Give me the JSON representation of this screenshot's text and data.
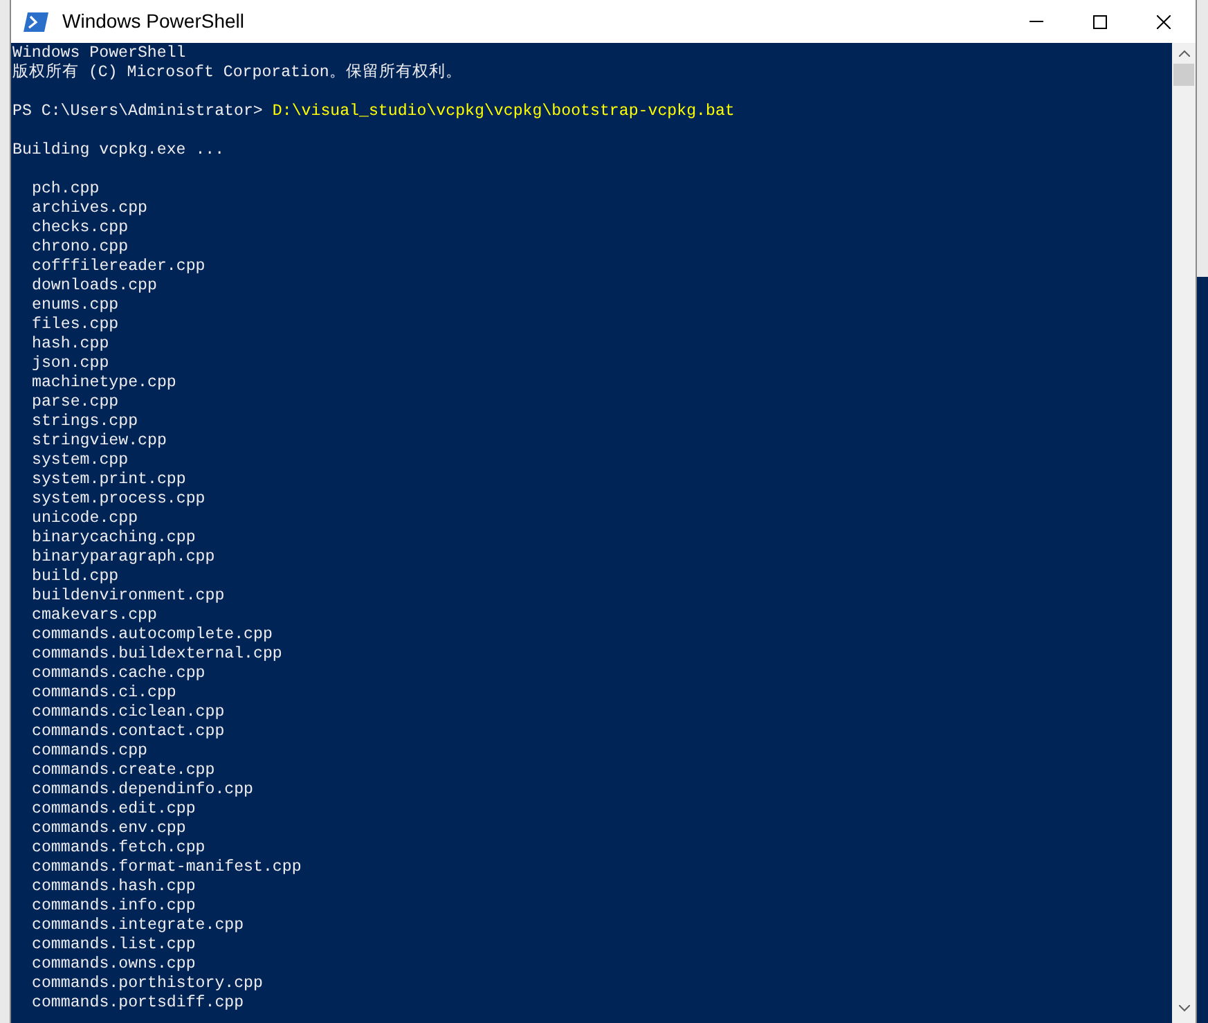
{
  "window": {
    "title": "Windows PowerShell"
  },
  "console": {
    "lines": [
      {
        "kind": "output",
        "text": "Windows PowerShell"
      },
      {
        "kind": "output",
        "text": "版权所有 (C) Microsoft Corporation。保留所有权利。"
      },
      {
        "kind": "blank"
      },
      {
        "kind": "prompt",
        "prompt": "PS C:\\Users\\Administrator>",
        "command": "D:\\visual_studio\\vcpkg\\vcpkg\\bootstrap-vcpkg.bat"
      },
      {
        "kind": "blank"
      },
      {
        "kind": "output",
        "text": "Building vcpkg.exe ..."
      },
      {
        "kind": "blank"
      },
      {
        "kind": "item",
        "text": "pch.cpp"
      },
      {
        "kind": "item",
        "text": "archives.cpp"
      },
      {
        "kind": "item",
        "text": "checks.cpp"
      },
      {
        "kind": "item",
        "text": "chrono.cpp"
      },
      {
        "kind": "item",
        "text": "cofffilereader.cpp"
      },
      {
        "kind": "item",
        "text": "downloads.cpp"
      },
      {
        "kind": "item",
        "text": "enums.cpp"
      },
      {
        "kind": "item",
        "text": "files.cpp"
      },
      {
        "kind": "item",
        "text": "hash.cpp"
      },
      {
        "kind": "item",
        "text": "json.cpp"
      },
      {
        "kind": "item",
        "text": "machinetype.cpp"
      },
      {
        "kind": "item",
        "text": "parse.cpp"
      },
      {
        "kind": "item",
        "text": "strings.cpp"
      },
      {
        "kind": "item",
        "text": "stringview.cpp"
      },
      {
        "kind": "item",
        "text": "system.cpp"
      },
      {
        "kind": "item",
        "text": "system.print.cpp"
      },
      {
        "kind": "item",
        "text": "system.process.cpp"
      },
      {
        "kind": "item",
        "text": "unicode.cpp"
      },
      {
        "kind": "item",
        "text": "binarycaching.cpp"
      },
      {
        "kind": "item",
        "text": "binaryparagraph.cpp"
      },
      {
        "kind": "item",
        "text": "build.cpp"
      },
      {
        "kind": "item",
        "text": "buildenvironment.cpp"
      },
      {
        "kind": "item",
        "text": "cmakevars.cpp"
      },
      {
        "kind": "item",
        "text": "commands.autocomplete.cpp"
      },
      {
        "kind": "item",
        "text": "commands.buildexternal.cpp"
      },
      {
        "kind": "item",
        "text": "commands.cache.cpp"
      },
      {
        "kind": "item",
        "text": "commands.ci.cpp"
      },
      {
        "kind": "item",
        "text": "commands.ciclean.cpp"
      },
      {
        "kind": "item",
        "text": "commands.contact.cpp"
      },
      {
        "kind": "item",
        "text": "commands.cpp"
      },
      {
        "kind": "item",
        "text": "commands.create.cpp"
      },
      {
        "kind": "item",
        "text": "commands.dependinfo.cpp"
      },
      {
        "kind": "item",
        "text": "commands.edit.cpp"
      },
      {
        "kind": "item",
        "text": "commands.env.cpp"
      },
      {
        "kind": "item",
        "text": "commands.fetch.cpp"
      },
      {
        "kind": "item",
        "text": "commands.format-manifest.cpp"
      },
      {
        "kind": "item",
        "text": "commands.hash.cpp"
      },
      {
        "kind": "item",
        "text": "commands.info.cpp"
      },
      {
        "kind": "item",
        "text": "commands.integrate.cpp"
      },
      {
        "kind": "item",
        "text": "commands.list.cpp"
      },
      {
        "kind": "item",
        "text": "commands.owns.cpp"
      },
      {
        "kind": "item",
        "text": "commands.porthistory.cpp"
      },
      {
        "kind": "item",
        "text": "commands.portsdiff.cpp"
      }
    ]
  }
}
